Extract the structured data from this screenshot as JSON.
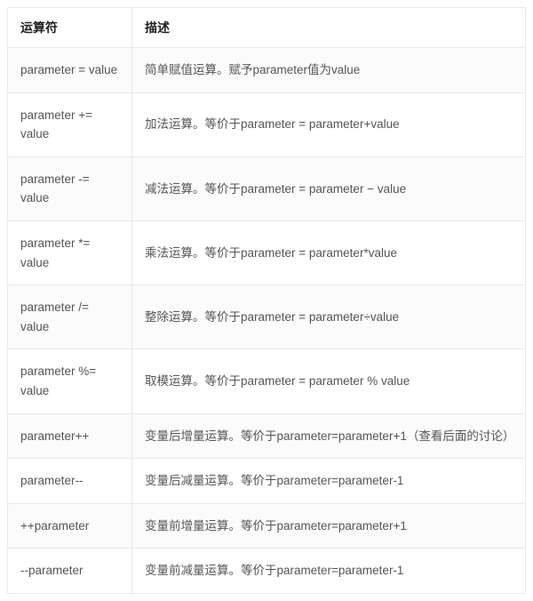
{
  "table": {
    "headers": {
      "operator": "运算符",
      "description": "描述"
    },
    "rows": [
      {
        "operator": "parameter = value",
        "description": "简单赋值运算。赋予parameter值为value"
      },
      {
        "operator": "parameter += value",
        "description": "加法运算。等价于parameter = parameter+value"
      },
      {
        "operator": "parameter -= value",
        "description": "减法运算。等价于parameter = parameter − value"
      },
      {
        "operator": "parameter *= value",
        "description": "乘法运算。等价于parameter = parameter*value"
      },
      {
        "operator": "parameter /= value",
        "description": "整除运算。等价于parameter = parameter÷value"
      },
      {
        "operator": "parameter %= value",
        "description": "取模运算。等价于parameter = parameter % value"
      },
      {
        "operator": "parameter++",
        "description": "变量后增量运算。等价于parameter=parameter+1（查看后面的讨论）"
      },
      {
        "operator": "parameter--",
        "description": "变量后减量运算。等价于parameter=parameter-1"
      },
      {
        "operator": "++parameter",
        "description": "变量前增量运算。等价于parameter=parameter+1"
      },
      {
        "operator": "--parameter",
        "description": "变量前减量运算。等价于parameter=parameter-1"
      }
    ]
  }
}
